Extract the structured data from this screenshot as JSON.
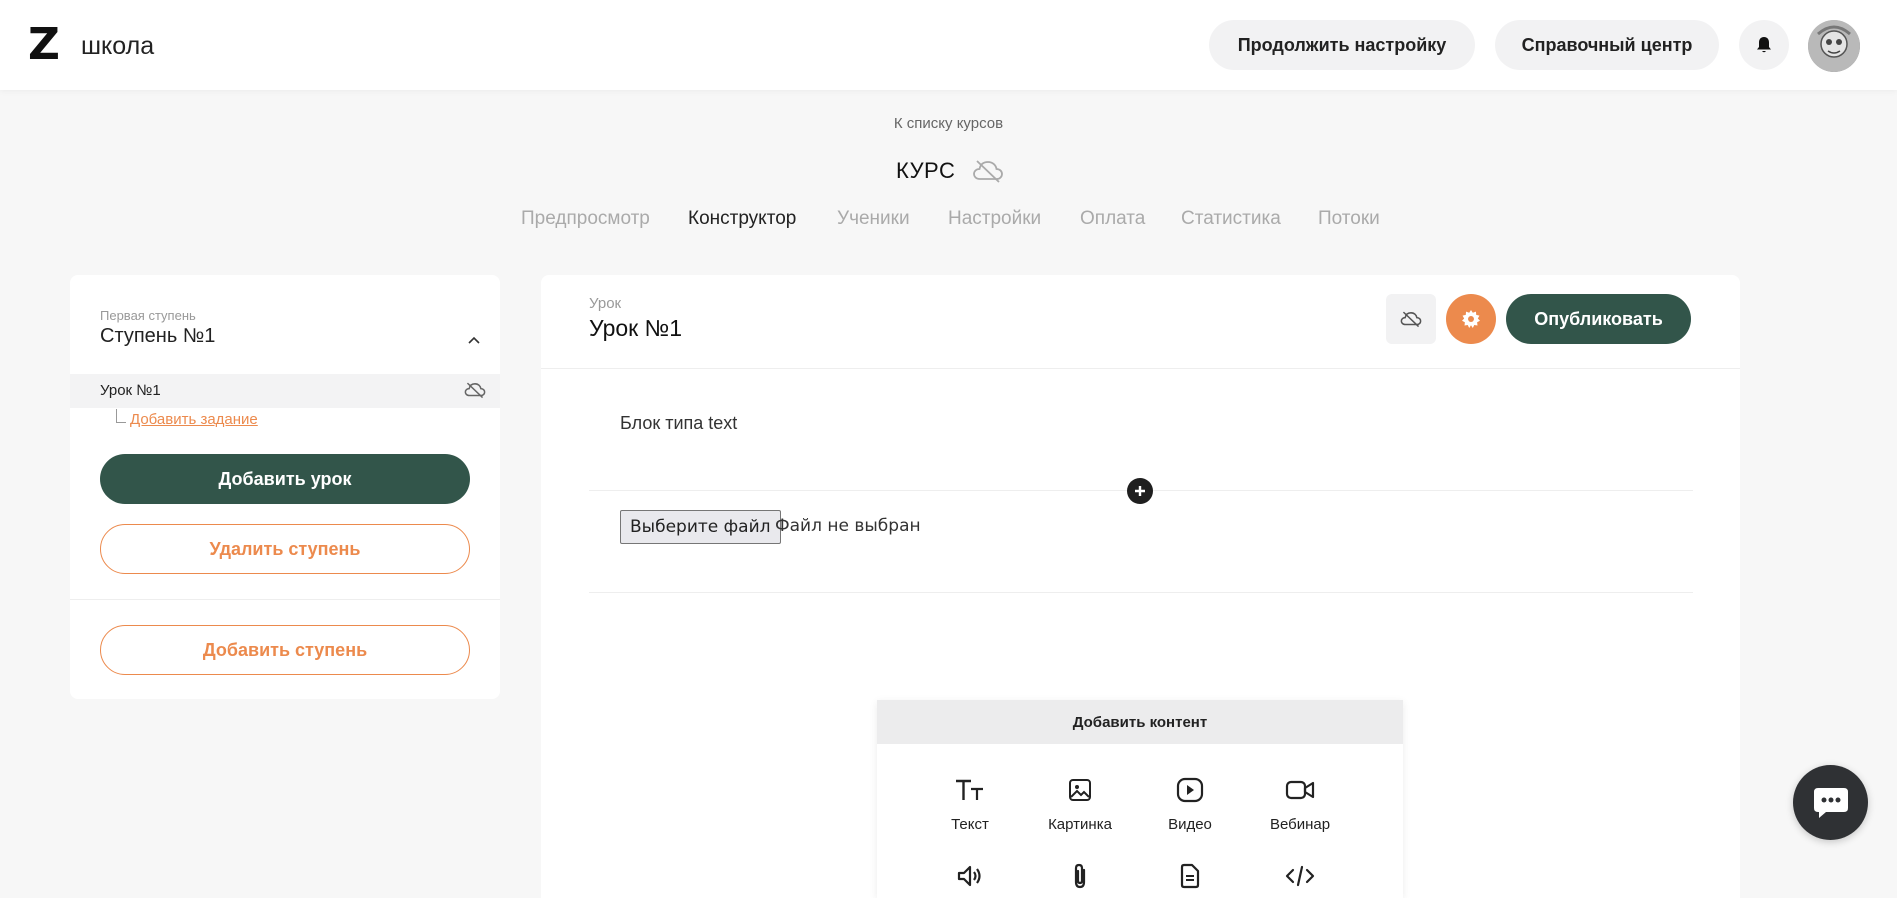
{
  "header": {
    "logo": "Z",
    "school": "школа",
    "continue_setup": "Продолжить настройку",
    "help_center": "Справочный центр"
  },
  "course": {
    "back_link": "К списку курсов",
    "title": "КУРС",
    "tabs": [
      "Предпросмотр",
      "Конструктор",
      "Ученики",
      "Настройки",
      "Оплата",
      "Статистика",
      "Потоки"
    ],
    "active_tab": "Конструктор"
  },
  "sidebar": {
    "stage_caption": "Первая ступень",
    "stage_title": "Ступень №1",
    "lessons": [
      {
        "name": "Урок №1"
      }
    ],
    "add_task": "Добавить задание",
    "add_lesson": "Добавить урок",
    "delete_stage": "Удалить ступень",
    "add_stage": "Добавить ступень"
  },
  "lesson": {
    "caption": "Урок",
    "title": "Урок №1",
    "publish": "Опубликовать",
    "block_text": "Блок типа text",
    "file_button": "Выберите файл",
    "file_status": "Файл не выбран"
  },
  "content_panel": {
    "title": "Добавить контент",
    "items": [
      {
        "icon": "text-icon",
        "label": "Текст"
      },
      {
        "icon": "image-icon",
        "label": "Картинка"
      },
      {
        "icon": "video-icon",
        "label": "Видео"
      },
      {
        "icon": "webinar-icon",
        "label": "Вебинар"
      },
      {
        "icon": "audio-icon",
        "label": ""
      },
      {
        "icon": "attachment-icon",
        "label": ""
      },
      {
        "icon": "document-icon",
        "label": ""
      },
      {
        "icon": "code-icon",
        "label": ""
      }
    ]
  },
  "colors": {
    "primary": "#32554a",
    "accent": "#ec8a4d",
    "background": "#f7f7f7"
  }
}
